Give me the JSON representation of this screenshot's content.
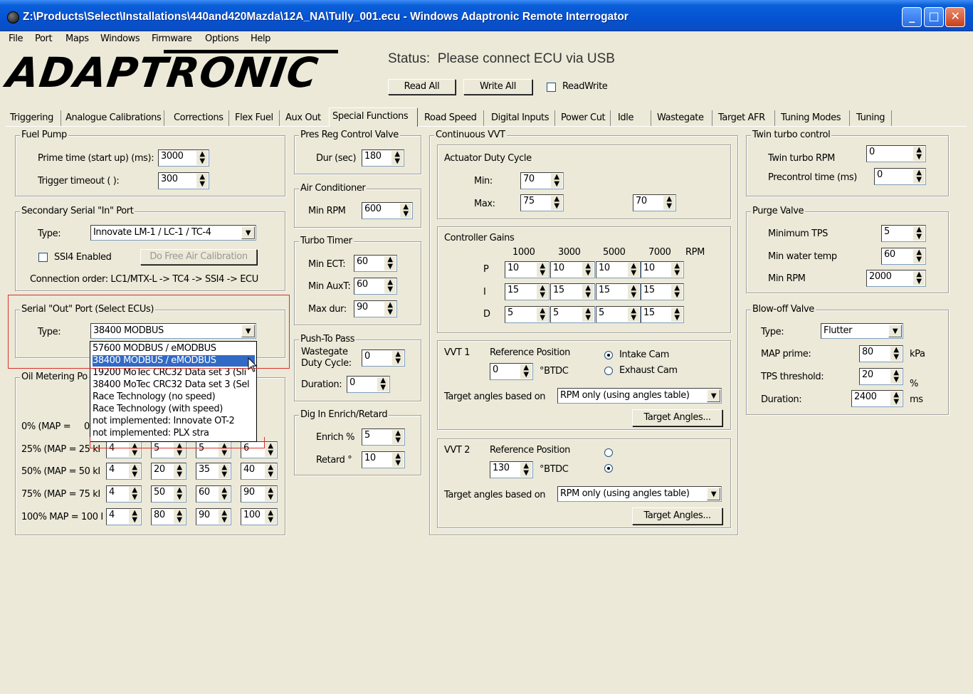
{
  "window": {
    "title": "Z:\\Products\\Select\\Installations\\440and420Mazda\\12A_NA\\Tully_001.ecu - Windows Adaptronic Remote Interrogator"
  },
  "menu": [
    "File",
    "Port",
    "Maps",
    "Windows",
    "Firmware",
    "Options",
    "Help"
  ],
  "logo": "ADAPTRONIC",
  "status": {
    "label": "Status:",
    "text": "Please connect ECU via USB"
  },
  "toolbar": {
    "read_all": "Read All",
    "write_all": "Write All",
    "readwrite": "ReadWrite"
  },
  "tabs": [
    "Triggering",
    "Analogue Calibrations",
    "Corrections",
    "Flex Fuel",
    "Aux Out",
    "Special Functions",
    "Road Speed",
    "Digital Inputs",
    "Power Cut",
    "Idle",
    "Wastegate",
    "Target AFR",
    "Tuning Modes",
    "Tuning"
  ],
  "fuel_pump": {
    "title": "Fuel Pump",
    "prime_label": "Prime time (start up) (ms):",
    "prime": "3000",
    "trigger_label": "Trigger timeout (   ):",
    "trigger": "300"
  },
  "secondary_serial": {
    "title": "Secondary Serial \"In\" Port",
    "type_label": "Type:",
    "type": "Innovate LM-1 / LC-1 / TC-4",
    "ssi4": "SSI4 Enabled",
    "free_air": "Do Free Air Calibration",
    "order": "Connection order: LC1/MTX-L -> TC4 -> SSI4 -> ECU"
  },
  "serial_out": {
    "title": "Serial \"Out\" Port (Select ECUs)",
    "type_label": "Type:",
    "type": "38400 MODBUS",
    "options": [
      "57600 MODBUS / eMODBUS",
      "38400 MODBUS / eMODBUS",
      "19200 MoTec CRC32 Data set 3 (Sli",
      "38400 MoTec CRC32 Data set 3 (Sel",
      "Race Technology (no speed)",
      "Race Technology (with speed)",
      "not implemented: Innovate OT-2",
      "not implemented: PLX stra"
    ]
  },
  "oil_metering": {
    "title": "Oil Metering Po",
    "rows": [
      {
        "label": "0% (MAP =",
        "vals": [
          "0"
        ]
      },
      {
        "label": "25% (MAP = 25 kI",
        "vals": [
          "4",
          "5",
          "5",
          "6"
        ]
      },
      {
        "label": "50% (MAP = 50 kI",
        "vals": [
          "4",
          "20",
          "35",
          "40"
        ]
      },
      {
        "label": "75% (MAP = 75 kI",
        "vals": [
          "4",
          "50",
          "60",
          "90"
        ]
      },
      {
        "label": "100% MAP = 100 I",
        "vals": [
          "4",
          "80",
          "90",
          "100"
        ]
      }
    ]
  },
  "pres_reg": {
    "title": "Pres Reg Control Valve",
    "dur_label": "Dur (sec)",
    "dur": "180"
  },
  "air_cond": {
    "title": "Air Conditioner",
    "rpm_label": "Min RPM",
    "rpm": "600"
  },
  "turbo_timer": {
    "title": "Turbo Timer",
    "ect_label": "Min ECT:",
    "ect": "60",
    "aux_label": "Min AuxT:",
    "aux": "60",
    "dur_label": "Max dur:",
    "dur": "90"
  },
  "push_to_pass": {
    "title": "Push-To Pass",
    "wg_label1": "Wastegate",
    "wg_label2": "Duty Cycle:",
    "wg": "0",
    "dur_label": "Duration:",
    "dur": "0"
  },
  "dig_in": {
    "title": "Dig In Enrich/Retard",
    "enrich_label": "Enrich %",
    "enrich": "5",
    "retard_label": "Retard °",
    "retard": "10"
  },
  "vvt": {
    "title": "Continuous VVT",
    "actuator_title": "Actuator Duty Cycle",
    "min_label": "Min:",
    "min": "70",
    "max_label": "Max:",
    "max": "75",
    "extra": "70",
    "gains_title": "Controller Gains",
    "rpm_headers": [
      "1000",
      "3000",
      "5000",
      "7000",
      "RPM"
    ],
    "gains": [
      {
        "label": "P",
        "vals": [
          "10",
          "10",
          "10",
          "10"
        ]
      },
      {
        "label": "I",
        "vals": [
          "15",
          "15",
          "15",
          "15"
        ]
      },
      {
        "label": "D",
        "vals": [
          "5",
          "5",
          "5",
          "15"
        ]
      }
    ],
    "vvt1": {
      "label": "VVT 1",
      "ref_label": "Reference Position",
      "ref": "0",
      "unit": "°BTDC",
      "intake": "Intake Cam",
      "exhaust": "Exhaust Cam",
      "target_label": "Target angles based on",
      "target": "RPM only (using angles table)",
      "button": "Target Angles..."
    },
    "vvt2": {
      "label": "VVT 2",
      "ref_label": "Reference Position",
      "ref": "130",
      "unit": "°BTDC",
      "target_label": "Target angles based on",
      "target": "RPM only (using angles table)",
      "button": "Target Angles..."
    }
  },
  "twin_turbo": {
    "title": "Twin turbo control",
    "rpm_label": "Twin turbo RPM",
    "rpm": "0",
    "pre_label": "Precontrol time (ms)",
    "pre": "0"
  },
  "purge": {
    "title": "Purge Valve",
    "tps_label": "Minimum TPS",
    "tps": "5",
    "water_label": "Min water temp",
    "water": "60",
    "rpm_label": "Min RPM",
    "rpm": "2000"
  },
  "blowoff": {
    "title": "Blow-off Valve",
    "type_label": "Type:",
    "type": "Flutter",
    "map_label": "MAP prime:",
    "map": "80",
    "map_unit": "kPa",
    "tps_label": "TPS threshold:",
    "tps": "20",
    "tps_unit": "%",
    "dur_label": "Duration:",
    "dur": "2400",
    "dur_unit": "ms"
  }
}
